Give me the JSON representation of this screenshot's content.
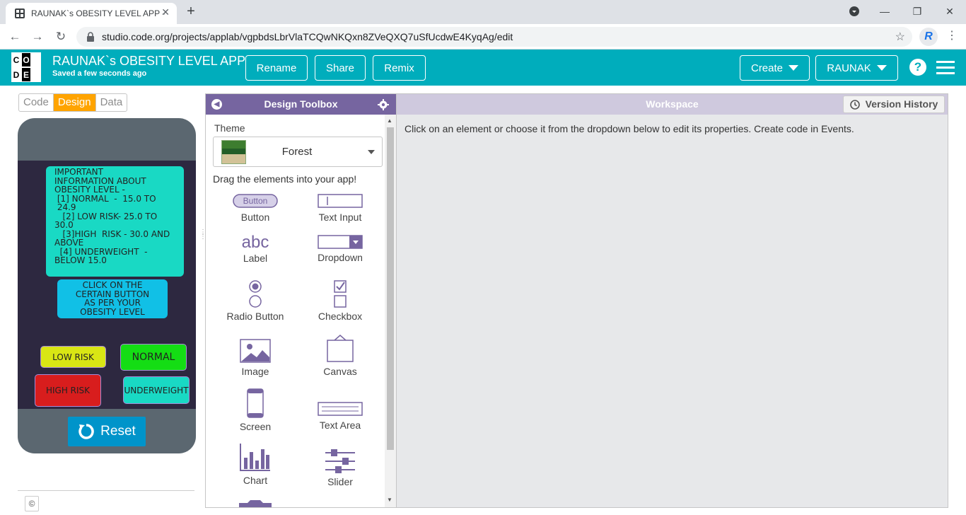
{
  "browser": {
    "tab_title": "RAUNAK`s OBESITY LEVEL APP - ",
    "url": "studio.code.org/projects/applab/vgpbdsLbrVlaTCQwNKQxn8ZVeQXQ7uSfUcdwE4KyqAg/edit",
    "profile_initial": "R"
  },
  "header": {
    "logo_letters": [
      "C",
      "O",
      "D",
      "E"
    ],
    "app_title": "RAUNAK`s OBESITY LEVEL APP",
    "saved_status": "Saved a few seconds ago",
    "rename_label": "Rename",
    "share_label": "Share",
    "remix_label": "Remix",
    "create_label": "Create",
    "user_label": "RAUNAK",
    "help_label": "?"
  },
  "modes": {
    "code": "Code",
    "design": "Design",
    "data": "Data",
    "active": "Design"
  },
  "app_preview": {
    "info_text": "IMPORTANT\nINFORMATION ABOUT\nOBESITY LEVEL -\n [1] NORMAL  -  15.0 TO\n 24.9\n   [2] LOW RISK- 25.0 TO\n30.0\n   [3]HIGH  RISK - 30.0 AND\nABOVE\n  [4] UNDERWEIGHT  -\nBELOW 15.0",
    "click_text": "CLICK ON THE\nCERTAIN BUTTON\nAS PER YOUR\nOBESITY LEVEL",
    "low_risk": "LOW RISK",
    "normal": "NORMAL",
    "high_risk": "HIGH RISK",
    "underweight": "UNDERWEIGHT",
    "reset": "Reset",
    "colors": {
      "screen_bg": "#2d2840",
      "info_bg": "#19d9c4",
      "click_bg": "#11c0e6",
      "low_risk_bg": "#d9e614",
      "normal_bg": "#14dd14",
      "high_risk_bg": "#d81d1d",
      "underweight_bg": "#19d9c4"
    }
  },
  "footer": {
    "copyright": "©"
  },
  "toolbox": {
    "title": "Design Toolbox",
    "theme_label": "Theme",
    "theme_value": "Forest",
    "drag_label": "Drag the elements into your app!",
    "tools": [
      {
        "label": "Button",
        "icon": "button-icon"
      },
      {
        "label": "Text Input",
        "icon": "text-input-icon"
      },
      {
        "label": "Label",
        "icon": "label-icon"
      },
      {
        "label": "Dropdown",
        "icon": "dropdown-icon"
      },
      {
        "label": "Radio Button",
        "icon": "radio-button-icon"
      },
      {
        "label": "Checkbox",
        "icon": "checkbox-icon"
      },
      {
        "label": "Image",
        "icon": "image-icon"
      },
      {
        "label": "Canvas",
        "icon": "canvas-icon"
      },
      {
        "label": "Screen",
        "icon": "screen-icon"
      },
      {
        "label": "Text Area",
        "icon": "text-area-icon"
      },
      {
        "label": "Chart",
        "icon": "chart-icon"
      },
      {
        "label": "Slider",
        "icon": "slider-icon"
      }
    ],
    "button_icon_text": "Button",
    "label_icon_text": "abc"
  },
  "workspace": {
    "title": "Workspace",
    "version_history": "Version History",
    "hint": "Click on an element or choose it from the dropdown below to edit its properties. Create code in Events."
  }
}
